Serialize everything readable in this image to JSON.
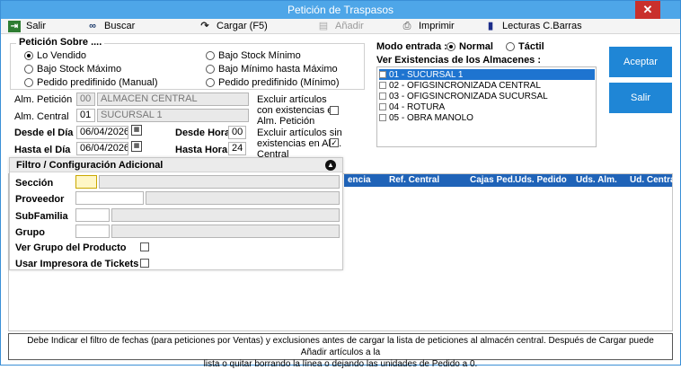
{
  "window": {
    "title": "Petición de Traspasos",
    "close_glyph": "✕"
  },
  "toolbar": {
    "salir": "Salir",
    "buscar": "Buscar",
    "cargar": "Cargar (F5)",
    "anadir": "Añadir",
    "imprimir": "Imprimir",
    "lecturas": "Lecturas C.Barras"
  },
  "peticion_sobre": {
    "legend": "Petición Sobre ....",
    "options": [
      {
        "label": "Lo Vendido",
        "selected": true
      },
      {
        "label": "Bajo Stock Mínimo",
        "selected": false
      },
      {
        "label": "Bajo Stock Máximo",
        "selected": false
      },
      {
        "label": "Bajo Mínimo hasta Máximo",
        "selected": false
      },
      {
        "label": "Pedido predifinido (Manual)",
        "selected": false
      },
      {
        "label": "Pedido predifinido (Mínimo)",
        "selected": false
      }
    ]
  },
  "form": {
    "alm_peticion_label": "Alm. Petición",
    "alm_peticion_code": "00",
    "alm_peticion_name": "ALMACEN CENTRAL",
    "alm_central_label": "Alm. Central",
    "alm_central_code": "01",
    "alm_central_name": "SUCURSAL 1",
    "desde_dia_label": "Desde el Día",
    "desde_dia": "06/04/2026",
    "hasta_dia_label": "Hasta el Día",
    "hasta_dia": "06/04/2026",
    "desde_hora_label": "Desde Hora",
    "desde_hora": "00",
    "hasta_hora_label": "Hasta Hora",
    "hasta_hora": "24",
    "excluir_con_line1": "Excluir artículos",
    "excluir_con_line2": "con existencias en",
    "excluir_con_line3": "Alm. Petición",
    "excluir_con_checked": false,
    "excluir_sin_line1": "Excluir artículos sin",
    "excluir_sin_line2": "existencias en Alm.",
    "excluir_sin_line3": "Central",
    "excluir_sin_checked": true
  },
  "modo_entrada": {
    "label": "Modo entrada :",
    "normal": "Normal",
    "tactil": "Táctil",
    "selected": "normal"
  },
  "almacenes": {
    "label": "Ver Existencias de los Almacenes :",
    "items": [
      {
        "label": "01 - SUCURSAL 1",
        "selected": true,
        "checked": false
      },
      {
        "label": "02 - OFIGSINCRONIZADA CENTRAL",
        "selected": false,
        "checked": false
      },
      {
        "label": "03 - OFIGSINCRONIZADA SUCURSAL",
        "selected": false,
        "checked": false
      },
      {
        "label": "04 - ROTURA",
        "selected": false,
        "checked": false
      },
      {
        "label": "05 - OBRA MANOLO",
        "selected": false,
        "checked": false
      }
    ]
  },
  "buttons": {
    "aceptar": "Aceptar",
    "salir": "Salir"
  },
  "filtro": {
    "title": "Filtro / Configuración Adicional",
    "collapse_icon": "chevron-up-icon",
    "seccion_label": "Sección",
    "seccion_value": "",
    "proveedor_label": "Proveedor",
    "proveedor_value": "",
    "subfamilia_label": "SubFamilia",
    "subfamilia_value": "",
    "grupo_label": "Grupo",
    "grupo_value": "",
    "ver_grupo_label": "Ver Grupo del Producto",
    "ver_grupo_checked": false,
    "usar_impresora_label": "Usar Impresora de Tickets",
    "usar_impresora_checked": false
  },
  "grid": {
    "columns": [
      "encia",
      "Ref. Central",
      "Cajas Ped.",
      "Uds. Pedido",
      "Uds. Alm.",
      "Ud. Central"
    ]
  },
  "status": {
    "line1": "Debe Indicar el filtro de fechas (para peticiones por Ventas) y exclusiones antes de cargar la lista de peticiones al almacén central. Después de Cargar puede Añadir artículos a la",
    "line2": "lista o quitar borrando la línea o dejando las unidades de Pedido a 0."
  },
  "colors": {
    "titlebar": "#4ea6e8",
    "selection": "#1e74d0",
    "grid_header": "#1f63b8",
    "button": "#1f86d6",
    "close": "#c9302c"
  }
}
